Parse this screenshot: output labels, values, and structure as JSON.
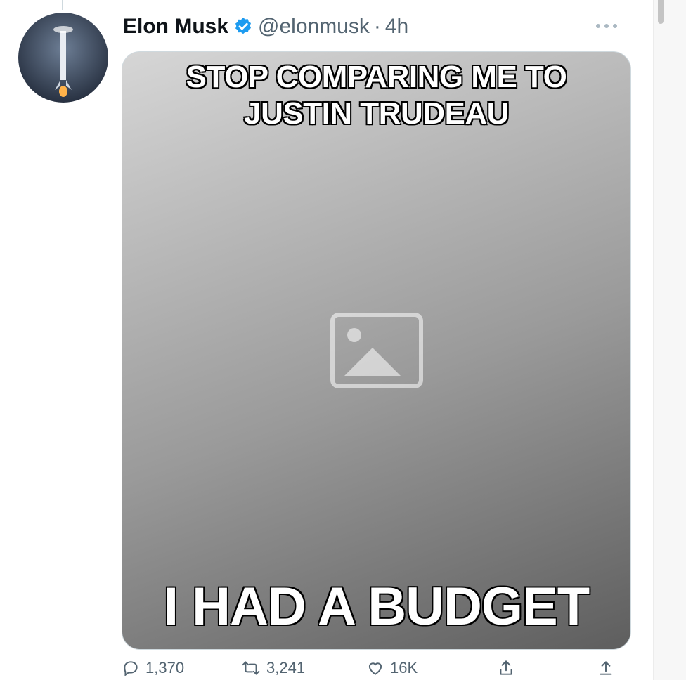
{
  "tweet": {
    "author": {
      "display_name": "Elon Musk",
      "handle": "@elonmusk",
      "separator": "·",
      "timestamp": "4h",
      "verified": true,
      "verified_icon": "verified-badge-icon",
      "avatar_icon": "rocket-launch-avatar"
    },
    "media": {
      "caption_top": "STOP COMPARING ME TO JUSTIN TRUDEAU",
      "caption_bottom": "I HAD A BUDGET",
      "placeholder_icon": "image-placeholder-icon"
    },
    "actions": {
      "reply_count": "1,370",
      "retweet_count": "3,241",
      "like_count": "16K"
    }
  },
  "colors": {
    "verified_blue": "#1d9bf0",
    "secondary_text": "#536471",
    "primary_text": "#0f1419"
  }
}
